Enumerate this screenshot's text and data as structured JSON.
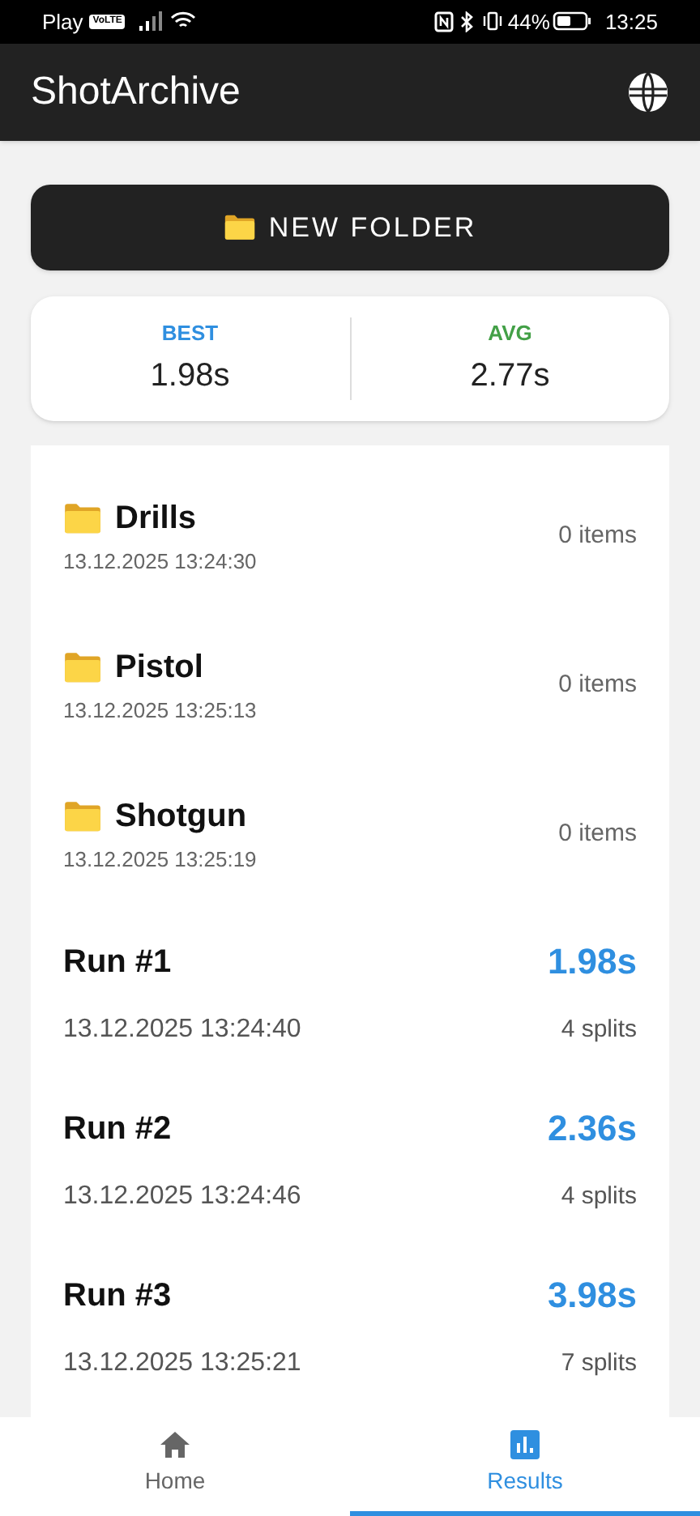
{
  "status_bar": {
    "carrier": "Play",
    "volte": "VoLTE",
    "battery": "44%",
    "time": "13:25"
  },
  "app_bar": {
    "title": "ShotArchive"
  },
  "new_folder_button": {
    "label": "NEW FOLDER"
  },
  "stats": [
    {
      "label": "BEST",
      "value": "1.98s",
      "color": "#2f8fe0"
    },
    {
      "label": "AVG",
      "value": "2.77s",
      "color": "#43a047"
    }
  ],
  "items": [
    {
      "kind": "folder",
      "title": "Drills",
      "date": "13.12.2025 13:24:30",
      "detail": "0 items"
    },
    {
      "kind": "folder",
      "title": "Pistol",
      "date": "13.12.2025 13:25:13",
      "detail": "0 items"
    },
    {
      "kind": "folder",
      "title": "Shotgun",
      "date": "13.12.2025 13:25:19",
      "detail": "0 items"
    },
    {
      "kind": "run",
      "title": "Run #1",
      "date": "13.12.2025 13:24:40",
      "time": "1.98s",
      "detail": "4 splits"
    },
    {
      "kind": "run",
      "title": "Run #2",
      "date": "13.12.2025 13:24:46",
      "time": "2.36s",
      "detail": "4 splits"
    },
    {
      "kind": "run",
      "title": "Run #3",
      "date": "13.12.2025 13:25:21",
      "time": "3.98s",
      "detail": "7 splits"
    }
  ],
  "bottom_nav": [
    {
      "label": "Home",
      "kind": "home",
      "selected": false
    },
    {
      "label": "Results",
      "kind": "results",
      "selected": true
    }
  ]
}
